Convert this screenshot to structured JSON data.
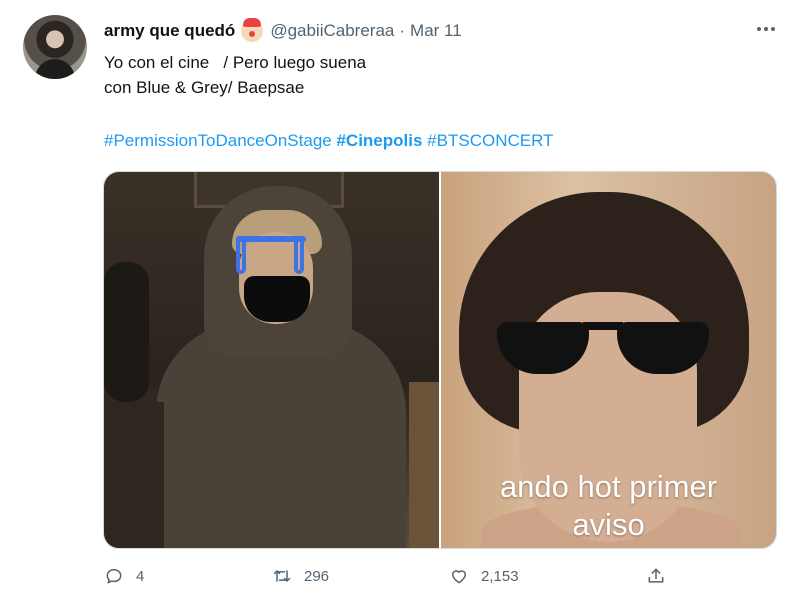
{
  "tweet": {
    "display_name": "army que quedó",
    "handle": "@gabiiCabreraa",
    "separator": "·",
    "date": "Mar 11",
    "text_line1": "Yo con el cine   / Pero luego suena",
    "text_line2": "con Blue & Grey/ Baepsae",
    "hashtags": [
      {
        "text": "#PermissionToDanceOnStage",
        "bold": false
      },
      {
        "text": "#Cinepolis",
        "bold": true
      },
      {
        "text": "#BTSCONCERT",
        "bold": false
      }
    ],
    "meme_caption": "ando hot primer\naviso"
  },
  "actions": {
    "reply_count": "4",
    "retweet_count": "296",
    "like_count": "2,153"
  },
  "colors": {
    "link": "#1d9bf0",
    "secondary_text": "#536471",
    "primary_text": "#0f1419",
    "border": "#cfd9de"
  },
  "icons": [
    "clown-face-emoji",
    "more-icon",
    "reply-icon",
    "retweet-icon",
    "like-icon",
    "share-icon"
  ]
}
